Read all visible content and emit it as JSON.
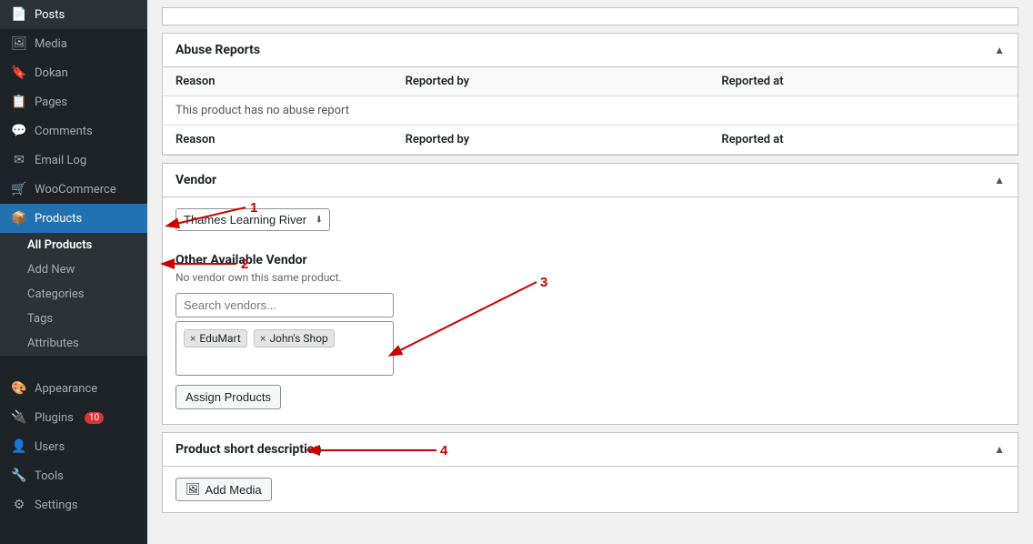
{
  "sidebar": {
    "items": [
      {
        "id": "posts",
        "label": "Posts",
        "icon": "📄"
      },
      {
        "id": "media",
        "label": "Media",
        "icon": "🖼"
      },
      {
        "id": "dokan",
        "label": "Dokan",
        "icon": "🔖"
      },
      {
        "id": "pages",
        "label": "Pages",
        "icon": "📋"
      },
      {
        "id": "comments",
        "label": "Comments",
        "icon": "💬"
      },
      {
        "id": "email-log",
        "label": "Email Log",
        "icon": "✉"
      },
      {
        "id": "woocommerce",
        "label": "WooCommerce",
        "icon": "🛒"
      },
      {
        "id": "products",
        "label": "Products",
        "icon": "📦",
        "active": true
      }
    ],
    "sub_items": [
      {
        "id": "all-products",
        "label": "All Products",
        "active": true
      },
      {
        "id": "add-new",
        "label": "Add New"
      },
      {
        "id": "categories",
        "label": "Categories"
      },
      {
        "id": "tags",
        "label": "Tags"
      },
      {
        "id": "attributes",
        "label": "Attributes"
      }
    ],
    "bottom_items": [
      {
        "id": "appearance",
        "label": "Appearance",
        "icon": "🎨"
      },
      {
        "id": "plugins",
        "label": "Plugins",
        "icon": "🔌",
        "badge": "10"
      },
      {
        "id": "users",
        "label": "Users",
        "icon": "👤"
      },
      {
        "id": "tools",
        "label": "Tools",
        "icon": "🔧"
      },
      {
        "id": "settings",
        "label": "Settings",
        "icon": "⚙"
      }
    ]
  },
  "main": {
    "abuse_reports": {
      "title": "Abuse Reports",
      "columns": [
        "Reason",
        "Reported by",
        "Reported at"
      ],
      "no_report_text": "This product has no abuse report",
      "second_row_columns": [
        "Reason",
        "Reported by",
        "Reported at"
      ]
    },
    "vendor": {
      "title": "Vendor",
      "selected": "Thames Learning River",
      "options": [
        "Thames Learning River",
        "EduMart",
        "John's Shop"
      ]
    },
    "other_vendor": {
      "title": "Other Available Vendor",
      "sub_text": "No vendor own this same product.",
      "search_placeholder": "Search vendors...",
      "tags": [
        "EduMart",
        "John's Shop"
      ],
      "assign_button": "Assign Products"
    },
    "product_short_description": {
      "title": "Product short description",
      "add_media_label": "Add Media"
    }
  },
  "annotations": {
    "1": "1",
    "2": "2",
    "3": "3",
    "4": "4"
  }
}
